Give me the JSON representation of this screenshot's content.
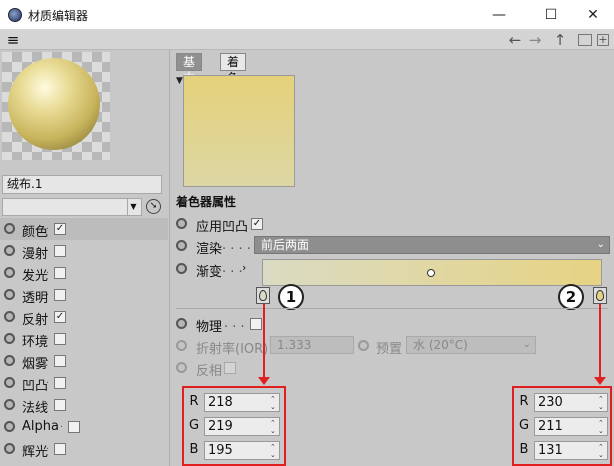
{
  "window": {
    "title": "材质编辑器",
    "controls": {
      "minimize": "—",
      "maximize": "☐",
      "close": "✕"
    }
  },
  "toolbar": {
    "menu_icon": "≡",
    "back": "←",
    "forward": "→",
    "up": "↑",
    "lock": "🔒",
    "add": "+"
  },
  "material": {
    "name": "绒布.1"
  },
  "channels": [
    {
      "label": "颜色",
      "checked": true,
      "selected": true
    },
    {
      "label": "漫射",
      "checked": false
    },
    {
      "label": "发光",
      "checked": false
    },
    {
      "label": "透明",
      "checked": false
    },
    {
      "label": "反射",
      "checked": true
    },
    {
      "label": "环境",
      "checked": false
    },
    {
      "label": "烟雾",
      "checked": false
    },
    {
      "label": "凹凸",
      "checked": false
    },
    {
      "label": "法线",
      "checked": false
    },
    {
      "label": "Alpha",
      "checked": false
    },
    {
      "label": "辉光",
      "checked": false
    }
  ],
  "tabs": [
    "基本",
    "着色器"
  ],
  "active_tab": "着色器",
  "shader": {
    "section_title": "着色器属性",
    "apply_bump": {
      "label": "应用凹凸",
      "checked": true
    },
    "render": {
      "label": "渲染",
      "value": "前后两面"
    },
    "gradient": {
      "label": "渐变"
    },
    "physical": {
      "label": "物理",
      "checked": false
    },
    "ior": {
      "label": "折射率(IOR)",
      "value": "1.333"
    },
    "preset": {
      "label": "预置",
      "value": "水 (20°C)"
    },
    "invert": {
      "label": "反相"
    }
  },
  "callouts": {
    "left": "1",
    "right": "2"
  },
  "color_left": {
    "R": "218",
    "G": "219",
    "B": "195"
  },
  "color_right": {
    "R": "230",
    "G": "211",
    "B": "131"
  },
  "colors": {
    "swatch_top": "#e5d17a",
    "gradient_left": "#dadbc3",
    "gradient_right": "#e6d383",
    "highlight": "#e02020"
  }
}
